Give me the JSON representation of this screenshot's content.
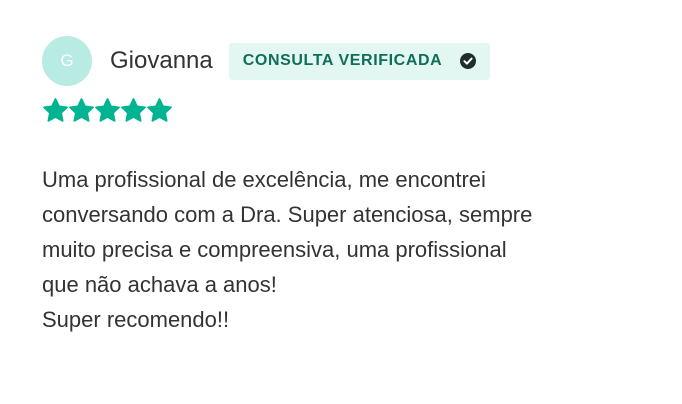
{
  "review": {
    "avatar_initial": "G",
    "author_name": "Giovanna",
    "badge_label": "CONSULTA VERIFICADA",
    "badge_icon": "check-circle-icon",
    "rating": 5,
    "rating_max": 5,
    "star_icon": "star-icon",
    "comment": "Uma profissional de excelência, me encontrei\nconversando com a Dra. Super atenciosa, sempre\nmuito precisa e compreensiva, uma profissional\nque não achava a anos!\nSuper recomendo!!",
    "colors": {
      "star": "#00b492",
      "badge_bg": "#e3f7f2",
      "badge_text": "#0f6e57",
      "avatar_bg": "#b8ece3"
    }
  }
}
